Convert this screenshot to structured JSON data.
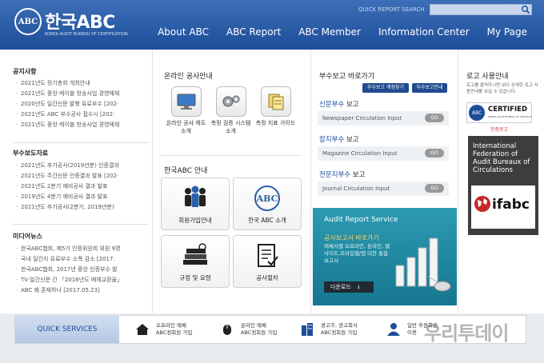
{
  "header": {
    "logo_mark": "ABC",
    "logo_title": "한국ABC",
    "logo_subtitle": "KOREA AUDIT BUREAU OF CERTIFICATION",
    "quick_search_label": "QUICK REPORT SEARCH",
    "quick_search_value": "",
    "nav": [
      "About ABC",
      "ABC Report",
      "ABC Member",
      "Information Center",
      "My Page"
    ]
  },
  "notices": {
    "title": "공지사항",
    "items": [
      "2021년도 정기총회 개최안내",
      "2021년도 중앙·케이블 방송사업 경영매체",
      "2020년도 일간신문 발행 유료부수 [202·",
      "2021년도 ABC 부수공사 접수시 [202·",
      "2021년도 중앙·케이블 방송사업 경영매체"
    ]
  },
  "press": {
    "title": "부수보도자료",
    "items": [
      "2021년도 추가공사(2019년분) 인증결과",
      "2021년도 주간신문 인증결과 발표 [202·",
      "2021년도 2분기 예비공사 결과 발표",
      "2019년도 4분기 예비공사 결과 발표",
      "2021년도 추가공사(2분기, 2019년분)"
    ]
  },
  "media": {
    "title": "미디어뉴스",
    "items": [
      "한국ABC협회, 제5기 인증위원회 위원 9명",
      "국내 일간지 유료부수 소폭 감소 [2017.",
      "한국ABC협회, 2017년 중앙 인증부수 발",
      "TV·일간신문 간 「2016년도 매체교환율」",
      "ABC 왜 존재하나 [2017.05.23]"
    ]
  },
  "online": {
    "title": "온라인 공사안내",
    "items": [
      {
        "icon": "monitor-icon",
        "label": "온라인 공사 제도소개"
      },
      {
        "icon": "gears-icon",
        "label": "측정 검증 시스템 소개"
      },
      {
        "icon": "documents-icon",
        "label": "측정 지표 가이드"
      }
    ]
  },
  "guide": {
    "title": "한국ABC 안내",
    "items": [
      {
        "icon": "people-icon",
        "label": "회원가입안내"
      },
      {
        "icon": "abc-logo-icon",
        "label": "한국 ABC 소개"
      },
      {
        "icon": "books-icon",
        "label": "규정 및 요령"
      },
      {
        "icon": "checklist-icon",
        "label": "공사절차"
      }
    ]
  },
  "report_shortcuts": {
    "title": "부수보고 바로가기",
    "btn_account": "부수보고 계정찾기",
    "btn_report": "부수보고안내",
    "go_label": "GO",
    "items": [
      {
        "head": "신문부수",
        "tail": " 보고",
        "sub": "Newspaper Circulation Input"
      },
      {
        "head": "잡지부수",
        "tail": " 보고",
        "sub": "Magazine Circulation Input"
      },
      {
        "head": "전문지부수",
        "tail": " 보고",
        "sub": "Journal Circulation Input"
      }
    ]
  },
  "audit_report": {
    "title": "Audit Report Service",
    "subtitle": "공사보고서 바로가기",
    "desc": "매체사별 오프라인, 온라인, 웹사이트,모바일웹/앱 대한 통합보고서",
    "download": "다운로드"
  },
  "logo_usage": {
    "title": "로고 사용안내",
    "desc": "로고를 클릭하시면 보다 상세한 로고 사용안내를 보실 수 있습니다.",
    "cert_big": "CERTIFIED",
    "cert_small": "KOREA AUDIT BUREAU OF CIRCULATIONS",
    "cert_caption": "인증로고",
    "ifabc_text": "International Federation of Audit Bureaux of Circulations",
    "ifabc_logo": "ifabc"
  },
  "quick_services": {
    "label": "QUICK SERVICES",
    "items": [
      {
        "icon": "house-icon",
        "line1": "오프라인 매체",
        "line2": "ABC정회원 가입"
      },
      {
        "icon": "mouse-icon",
        "line1": "온라인 매체",
        "line2": "ABC정회원 가입"
      },
      {
        "icon": "building-icon",
        "line1": "광고주, 광고회사",
        "line2": "ABC정회원 가입"
      },
      {
        "icon": "user-icon",
        "line1": "일반 후원회원",
        "line2": "이용"
      }
    ]
  },
  "watermark": "우리투데이",
  "colors": {
    "header": "#1d4d99",
    "accent": "#1f4b8f",
    "teal": "#16768f"
  }
}
